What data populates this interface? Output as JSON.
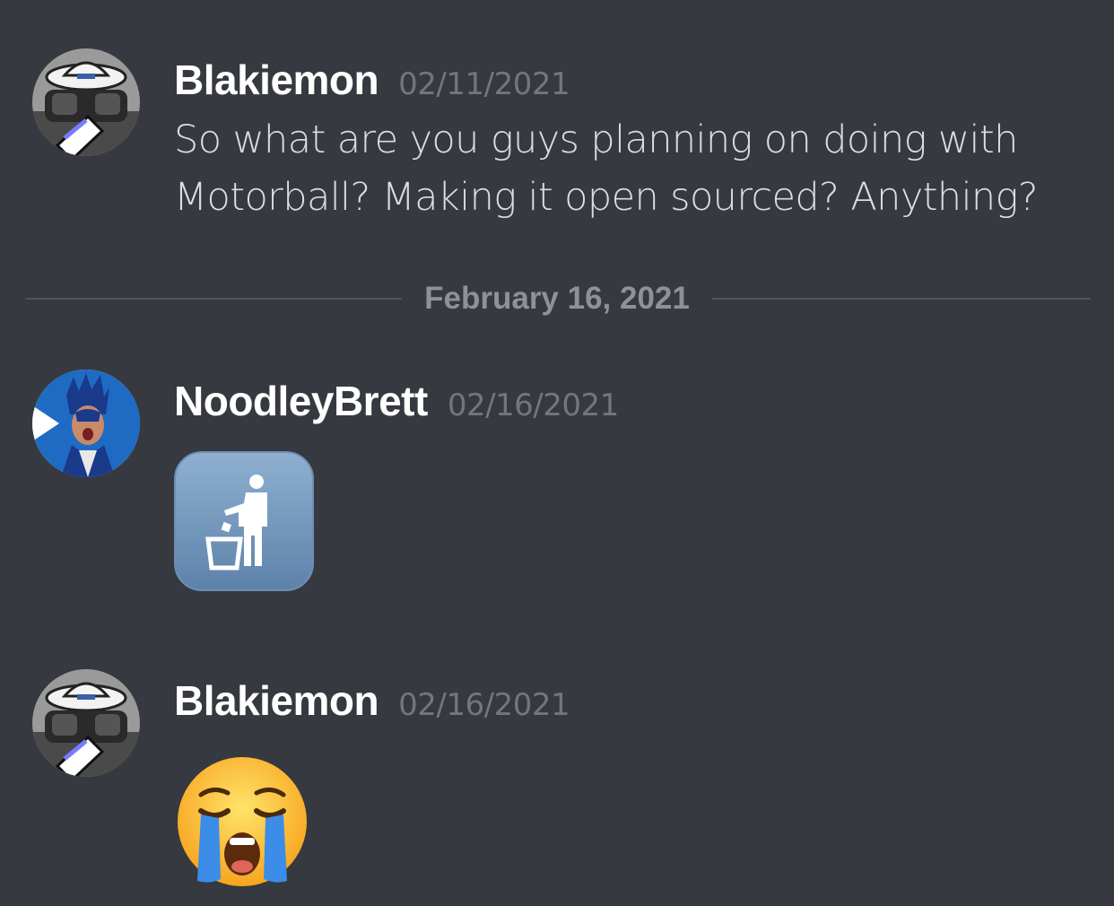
{
  "messages": [
    {
      "username": "Blakiemon",
      "timestamp": "02/11/2021",
      "text": "So what are you guys planning on doing with Motorball? Making it open sourced? Anything?"
    },
    {
      "username": "NoodleyBrett",
      "timestamp": "02/16/2021",
      "emoji": "litter-in-bin-emoji"
    },
    {
      "username": "Blakiemon",
      "timestamp": "02/16/2021",
      "emoji": "loudly-crying-face-emoji"
    }
  ],
  "date_divider": "February 16, 2021",
  "colors": {
    "background": "#36393f",
    "username": "#ffffff",
    "timestamp": "#72767d",
    "message_text": "#dcddde",
    "divider_line": "#4f545c",
    "divider_text": "#8e9297"
  }
}
